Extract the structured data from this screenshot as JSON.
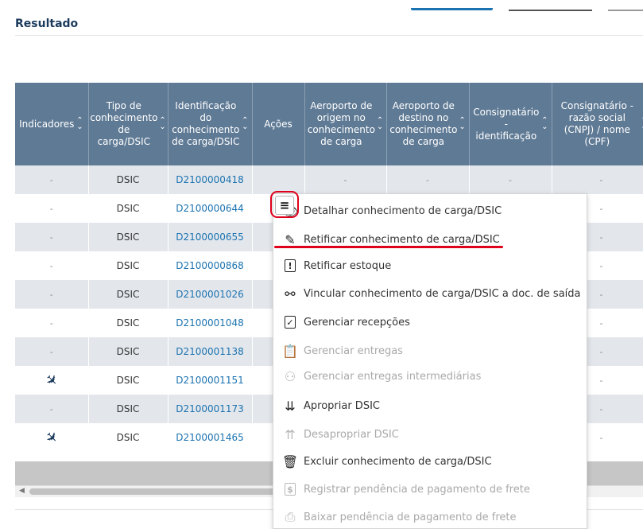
{
  "section": {
    "title": "Resultado"
  },
  "table": {
    "headers": [
      "Indicadores",
      "Tipo de conhecimento de carga/DSIC",
      "Identificação do conhecimento de carga/DSIC",
      "Ações",
      "Aeroporto de origem no conhecimento de carga",
      "Aeroporto de destino no conhecimento de carga",
      "Consignatário - identificação",
      "Consignatário - razão social (CNPJ) / nome (CPF)"
    ],
    "rows": [
      {
        "indicator": "-",
        "type": "DSIC",
        "id": "D2100000418",
        "origin": "-",
        "dest": "-",
        "cons_id": "-",
        "cons_name": "-"
      },
      {
        "indicator": "-",
        "type": "DSIC",
        "id": "D2100000644",
        "origin": "",
        "dest": "",
        "cons_id": "",
        "cons_name": "-"
      },
      {
        "indicator": "-",
        "type": "DSIC",
        "id": "D2100000655",
        "origin": "",
        "dest": "",
        "cons_id": "",
        "cons_name": "-"
      },
      {
        "indicator": "-",
        "type": "DSIC",
        "id": "D2100000868",
        "origin": "",
        "dest": "",
        "cons_id": "",
        "cons_name": "-"
      },
      {
        "indicator": "-",
        "type": "DSIC",
        "id": "D2100001026",
        "origin": "",
        "dest": "",
        "cons_id": "",
        "cons_name": "-"
      },
      {
        "indicator": "-",
        "type": "DSIC",
        "id": "D2100001048",
        "origin": "",
        "dest": "",
        "cons_id": "",
        "cons_name": "-"
      },
      {
        "indicator": "-",
        "type": "DSIC",
        "id": "D2100001138",
        "origin": "",
        "dest": "",
        "cons_id": "",
        "cons_name": "-"
      },
      {
        "indicator": "plane-icon",
        "type": "DSIC",
        "id": "D2100001151",
        "origin": "",
        "dest": "",
        "cons_id": "",
        "cons_name": "-"
      },
      {
        "indicator": "-",
        "type": "DSIC",
        "id": "D2100001173",
        "origin": "",
        "dest": "",
        "cons_id": "",
        "cons_name": "-"
      },
      {
        "indicator": "plane-icon",
        "type": "DSIC",
        "id": "D2100001465",
        "origin": "",
        "dest": "",
        "cons_id": "",
        "cons_name": "-"
      }
    ]
  },
  "actions_button": {
    "icon": "menu-icon",
    "glyph": "≡"
  },
  "menu": {
    "items": [
      {
        "label": "Detalhar conhecimento de carga/DSIC",
        "icon": "eye-icon",
        "enabled": true
      },
      {
        "label": "Retificar conhecimento de carga/DSIC",
        "icon": "pencil-icon",
        "enabled": true
      },
      {
        "label": "Retificar estoque",
        "icon": "exclamation-box-icon",
        "enabled": true
      },
      {
        "label": "Vincular conhecimento de carga/DSIC a doc. de saída",
        "icon": "link-icon",
        "enabled": true
      },
      {
        "label": "Gerenciar recepções",
        "icon": "checkbox-icon",
        "enabled": true
      },
      {
        "label": "Gerenciar entregas",
        "icon": "clipboard-icon",
        "enabled": false
      },
      {
        "label": "Gerenciar entregas intermediárias",
        "icon": "people-icon",
        "enabled": false
      },
      {
        "label": "Apropriar DSIC",
        "icon": "appropriate-icon",
        "enabled": true
      },
      {
        "label": "Desapropriar DSIC",
        "icon": "disappropriate-icon",
        "enabled": false
      },
      {
        "label": "Excluir conhecimento de carga/DSIC",
        "icon": "trash-icon",
        "enabled": true
      },
      {
        "label": "Registrar pendência de pagamento de frete",
        "icon": "dollar-doc-icon",
        "enabled": false
      },
      {
        "label": "Baixar pendência de pagamento de frete",
        "icon": "printer-icon",
        "enabled": false
      }
    ]
  },
  "colors": {
    "header_bg": "#5f7a95",
    "link": "#1b72b0",
    "highlight": "#e0001b",
    "stripe": "#e3e7ec"
  }
}
